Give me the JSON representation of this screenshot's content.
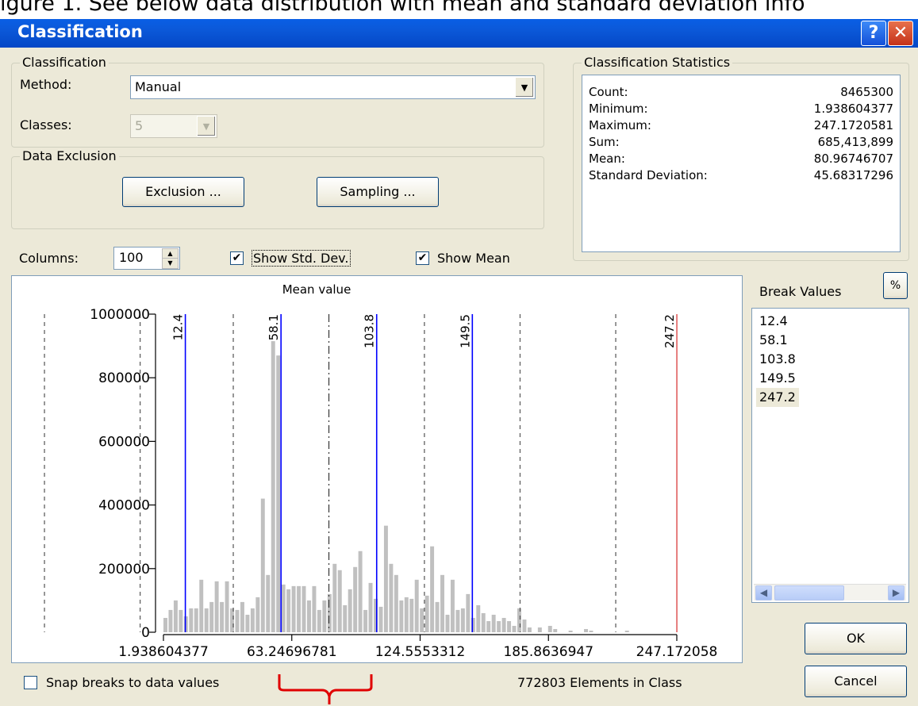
{
  "caption": "igure 1. See below data distribution with mean and standard deviation info",
  "window": {
    "title": "Classification",
    "help_label": "?",
    "close_label": "✕"
  },
  "classification_group": {
    "label": "Classification",
    "method_label": "Method:",
    "method_value": "Manual",
    "classes_label": "Classes:",
    "classes_value": "5"
  },
  "exclusion_group": {
    "label": "Data Exclusion",
    "exclusion_button": "Exclusion ...",
    "sampling_button": "Sampling ..."
  },
  "stats_group": {
    "label": "Classification Statistics",
    "rows": [
      {
        "key": "Count:",
        "value": "8465300"
      },
      {
        "key": "Minimum:",
        "value": "1.938604377"
      },
      {
        "key": "Maximum:",
        "value": "247.1720581"
      },
      {
        "key": "Sum:",
        "value": "685,413,899"
      },
      {
        "key": "Mean:",
        "value": "80.96746707"
      },
      {
        "key": "Standard Deviation:",
        "value": "45.68317296"
      }
    ]
  },
  "controls": {
    "columns_label": "Columns:",
    "columns_value": "100",
    "show_std_dev": "Show Std. Dev.",
    "show_std_dev_checked": true,
    "show_mean": "Show Mean",
    "show_mean_checked": true
  },
  "break_values": {
    "label": "Break Values",
    "percent_button": "%",
    "items": [
      "12.4",
      "58.1",
      "103.8",
      "149.5",
      "247.2"
    ],
    "selected_index": 4
  },
  "footer": {
    "snap_label": "Snap breaks to data values",
    "elements_in_class": "772803 Elements in Class",
    "ok_button": "OK",
    "cancel_button": "Cancel"
  },
  "colors": {
    "bar": "#c0c0c0",
    "break_line": "#0000ff",
    "max_break_line": "#e06060",
    "stddev_line": "#606060",
    "mean_line": "#404040",
    "annotation": "#e00000"
  },
  "chart_data": {
    "type": "bar",
    "annotation": "Mean value",
    "ylim": [
      0,
      1000000
    ],
    "xlim": [
      1.938604377,
      247.1720581
    ],
    "y_ticks": [
      0,
      200000,
      400000,
      600000,
      800000,
      1000000
    ],
    "y_tick_labels": [
      "0",
      "200000",
      "400000",
      "600000",
      "800000",
      "1000000"
    ],
    "x_tick_values": [
      1.938604377,
      63.24696781,
      124.5553312,
      185.8636947,
      247.1720581
    ],
    "x_tick_labels": [
      "1.938604377",
      "63.24696781",
      "124.5553312",
      "185.8636947",
      "247.172058"
    ],
    "bar_width": 2.45,
    "break_lines": [
      {
        "value": 12.4,
        "label": "12.4"
      },
      {
        "value": 58.1,
        "label": "58.1"
      },
      {
        "value": 103.8,
        "label": "103.8"
      },
      {
        "value": 149.5,
        "label": "149.5"
      },
      {
        "value": 247.2,
        "label": "247.2"
      }
    ],
    "mean": 80.96746707,
    "stddev_lines": [
      -54.9,
      -9.2,
      35.3,
      126.6,
      172.3,
      218.0
    ],
    "bars": [
      {
        "x": 1.94,
        "y": 45000
      },
      {
        "x": 4.39,
        "y": 70000
      },
      {
        "x": 6.84,
        "y": 100000
      },
      {
        "x": 9.29,
        "y": 70000
      },
      {
        "x": 11.74,
        "y": 50000
      },
      {
        "x": 14.19,
        "y": 75000
      },
      {
        "x": 16.64,
        "y": 75000
      },
      {
        "x": 19.09,
        "y": 165000
      },
      {
        "x": 21.54,
        "y": 75000
      },
      {
        "x": 23.99,
        "y": 95000
      },
      {
        "x": 26.44,
        "y": 160000
      },
      {
        "x": 28.89,
        "y": 95000
      },
      {
        "x": 31.34,
        "y": 160000
      },
      {
        "x": 33.79,
        "y": 75000
      },
      {
        "x": 36.24,
        "y": 70000
      },
      {
        "x": 38.69,
        "y": 95000
      },
      {
        "x": 41.14,
        "y": 55000
      },
      {
        "x": 43.59,
        "y": 75000
      },
      {
        "x": 46.04,
        "y": 110000
      },
      {
        "x": 48.49,
        "y": 420000
      },
      {
        "x": 50.94,
        "y": 180000
      },
      {
        "x": 53.39,
        "y": 915000
      },
      {
        "x": 55.84,
        "y": 870000
      },
      {
        "x": 58.29,
        "y": 150000
      },
      {
        "x": 60.74,
        "y": 135000
      },
      {
        "x": 63.19,
        "y": 145000
      },
      {
        "x": 65.64,
        "y": 145000
      },
      {
        "x": 68.09,
        "y": 145000
      },
      {
        "x": 70.54,
        "y": 100000
      },
      {
        "x": 72.99,
        "y": 145000
      },
      {
        "x": 75.44,
        "y": 70000
      },
      {
        "x": 77.89,
        "y": 100000
      },
      {
        "x": 80.34,
        "y": 120000
      },
      {
        "x": 82.79,
        "y": 215000
      },
      {
        "x": 85.24,
        "y": 195000
      },
      {
        "x": 87.69,
        "y": 85000
      },
      {
        "x": 90.14,
        "y": 135000
      },
      {
        "x": 92.59,
        "y": 205000
      },
      {
        "x": 95.04,
        "y": 255000
      },
      {
        "x": 97.49,
        "y": 70000
      },
      {
        "x": 99.94,
        "y": 155000
      },
      {
        "x": 102.39,
        "y": 105000
      },
      {
        "x": 104.84,
        "y": 80000
      },
      {
        "x": 107.29,
        "y": 335000
      },
      {
        "x": 109.74,
        "y": 215000
      },
      {
        "x": 112.19,
        "y": 180000
      },
      {
        "x": 114.64,
        "y": 100000
      },
      {
        "x": 117.09,
        "y": 110000
      },
      {
        "x": 119.54,
        "y": 105000
      },
      {
        "x": 121.99,
        "y": 165000
      },
      {
        "x": 124.44,
        "y": 75000
      },
      {
        "x": 126.89,
        "y": 115000
      },
      {
        "x": 129.34,
        "y": 270000
      },
      {
        "x": 131.79,
        "y": 95000
      },
      {
        "x": 134.24,
        "y": 180000
      },
      {
        "x": 136.69,
        "y": 55000
      },
      {
        "x": 139.14,
        "y": 165000
      },
      {
        "x": 141.59,
        "y": 70000
      },
      {
        "x": 144.04,
        "y": 75000
      },
      {
        "x": 146.49,
        "y": 120000
      },
      {
        "x": 148.94,
        "y": 45000
      },
      {
        "x": 151.39,
        "y": 85000
      },
      {
        "x": 153.84,
        "y": 60000
      },
      {
        "x": 156.29,
        "y": 35000
      },
      {
        "x": 158.74,
        "y": 55000
      },
      {
        "x": 161.19,
        "y": 35000
      },
      {
        "x": 163.64,
        "y": 45000
      },
      {
        "x": 166.09,
        "y": 35000
      },
      {
        "x": 168.54,
        "y": 20000
      },
      {
        "x": 170.99,
        "y": 75000
      },
      {
        "x": 173.44,
        "y": 40000
      },
      {
        "x": 175.89,
        "y": 15000
      },
      {
        "x": 180.79,
        "y": 15000
      },
      {
        "x": 185.69,
        "y": 20000
      },
      {
        "x": 188.14,
        "y": 10000
      },
      {
        "x": 195.49,
        "y": 5000
      },
      {
        "x": 202.84,
        "y": 10000
      },
      {
        "x": 205.29,
        "y": 5000
      },
      {
        "x": 222.44,
        "y": 5000
      }
    ]
  }
}
